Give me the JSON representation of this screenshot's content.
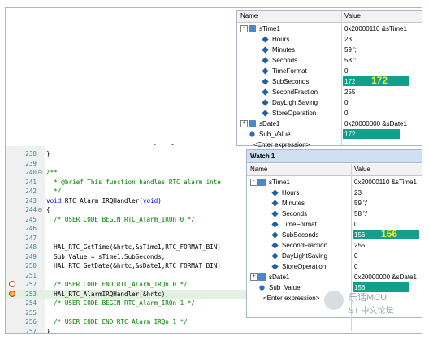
{
  "watch_top": {
    "col_name": "Name",
    "col_value": "Value",
    "rows": [
      {
        "name": "sTime1",
        "value": "0x20000110 &sTime1",
        "level": 0,
        "icon": "struct-icon",
        "expander": "-"
      },
      {
        "name": "Hours",
        "value": "23",
        "level": 1,
        "icon": "field-icon"
      },
      {
        "name": "Minutes",
        "value": "59 ';'",
        "level": 1,
        "icon": "field-icon"
      },
      {
        "name": "Seconds",
        "value": "58 ':'",
        "level": 1,
        "icon": "field-icon"
      },
      {
        "name": "TimeFormat",
        "value": "0",
        "level": 1,
        "icon": "field-icon"
      },
      {
        "name": "SubSeconds",
        "value": "172",
        "level": 1,
        "icon": "field-icon",
        "highlight": true,
        "big": "172"
      },
      {
        "name": "SecondFraction",
        "value": "255",
        "level": 1,
        "icon": "field-icon"
      },
      {
        "name": "DayLightSaving",
        "value": "0",
        "level": 1,
        "icon": "field-icon"
      },
      {
        "name": "StoreOperation",
        "value": "0",
        "level": 1,
        "icon": "field-icon"
      },
      {
        "name": "sDate1",
        "value": "0x20000000 &sDate1",
        "level": 0,
        "icon": "struct-icon",
        "expander": "+"
      },
      {
        "name": "Sub_Value",
        "value": "172",
        "level": 0,
        "icon": "var-icon",
        "highlight": true
      },
      {
        "name": "<Enter expression>",
        "value": "",
        "level": 0
      }
    ]
  },
  "watch_bottom": {
    "title": "Watch 1",
    "col_name": "Name",
    "col_value": "Value",
    "rows": [
      {
        "name": "sTime1",
        "value": "0x20000110 &sTime1",
        "level": 0,
        "icon": "struct-icon",
        "expander": "-"
      },
      {
        "name": "Hours",
        "value": "23",
        "level": 1,
        "icon": "field-icon"
      },
      {
        "name": "Minutes",
        "value": "59 ';'",
        "level": 1,
        "icon": "field-icon"
      },
      {
        "name": "Seconds",
        "value": "58 ':'",
        "level": 1,
        "icon": "field-icon"
      },
      {
        "name": "TimeFormat",
        "value": "0",
        "level": 1,
        "icon": "field-icon"
      },
      {
        "name": "SubSeconds",
        "value": "156",
        "level": 1,
        "icon": "field-icon",
        "highlight": true,
        "big": "156"
      },
      {
        "name": "SecondFraction",
        "value": "255",
        "level": 1,
        "icon": "field-icon"
      },
      {
        "name": "DayLightSaving",
        "value": "0",
        "level": 1,
        "icon": "field-icon"
      },
      {
        "name": "StoreOperation",
        "value": "0",
        "level": 1,
        "icon": "field-icon"
      },
      {
        "name": "sDate1",
        "value": "0x20000000 &sDate1",
        "level": 0,
        "icon": "struct-icon",
        "expander": "+"
      },
      {
        "name": "Sub_Value",
        "value": "156",
        "level": 0,
        "icon": "var-icon",
        "highlight": true
      },
      {
        "name": "<Enter expression>",
        "value": "",
        "level": 0
      }
    ]
  },
  "editor": {
    "lines": [
      {
        "n": "238",
        "fold": "",
        "code": "}",
        "cls": ""
      },
      {
        "n": "239",
        "fold": "",
        "code": "",
        "cls": ""
      },
      {
        "n": "240",
        "fold": "⊟",
        "code": "/**",
        "cls": "cm"
      },
      {
        "n": "241",
        "fold": "",
        "code": "  * @brief This function handles RTC alarm inte",
        "cls": "cm"
      },
      {
        "n": "242",
        "fold": "",
        "code": "  */",
        "cls": "cm"
      },
      {
        "n": "243",
        "fold": "",
        "code": "void RTC_Alarm_IRQHandler(void)",
        "cls": "fn"
      },
      {
        "n": "244",
        "fold": "⊟",
        "code": "{",
        "cls": ""
      },
      {
        "n": "245",
        "fold": "",
        "code": "  /* USER CODE BEGIN RTC_Alarm_IRQn 0 */",
        "cls": "cm"
      },
      {
        "n": "246",
        "fold": "",
        "code": "",
        "cls": ""
      },
      {
        "n": "247",
        "fold": "",
        "code": "",
        "cls": ""
      },
      {
        "n": "248",
        "fold": "",
        "code": "  HAL_RTC_GetTime(&hrtc,&sTime1,RTC_FORMAT_BIN)",
        "cls": ""
      },
      {
        "n": "249",
        "fold": "",
        "code": "  Sub_Value = sTime1.SubSeconds;",
        "cls": ""
      },
      {
        "n": "250",
        "fold": "",
        "code": "  HAL_RTC_GetDate(&hrtc,&sDate1,RTC_FORMAT_BIN)",
        "cls": ""
      },
      {
        "n": "251",
        "fold": "",
        "code": "",
        "cls": ""
      },
      {
        "n": "252",
        "fold": "",
        "code": "  /* USER CODE END RTC_Alarm_IRQn 0 */",
        "cls": "cm",
        "bp": "breakpoint"
      },
      {
        "n": "253",
        "fold": "",
        "code": "  HAL_RTC_AlarmIRQHandler(&hrtc);",
        "cls": "cur",
        "bp": "current"
      },
      {
        "n": "254",
        "fold": "",
        "code": "  /* USER CODE BEGIN RTC_Alarm_IRQn 1 */",
        "cls": "cm"
      },
      {
        "n": "255",
        "fold": "",
        "code": "",
        "cls": ""
      },
      {
        "n": "256",
        "fold": "",
        "code": "  /* USER CODE END RTC_Alarm_IRQn 1 */",
        "cls": "cm"
      },
      {
        "n": "257",
        "fold": "",
        "code": "}",
        "cls": ""
      },
      {
        "n": "258",
        "fold": "",
        "code": "",
        "cls": ""
      }
    ]
  },
  "watermark": {
    "line1": "乐话MCU",
    "line2": "ST 中文论坛"
  },
  "colors": {
    "highlight": "#12a08d",
    "big_value": "#f7ea1f"
  }
}
